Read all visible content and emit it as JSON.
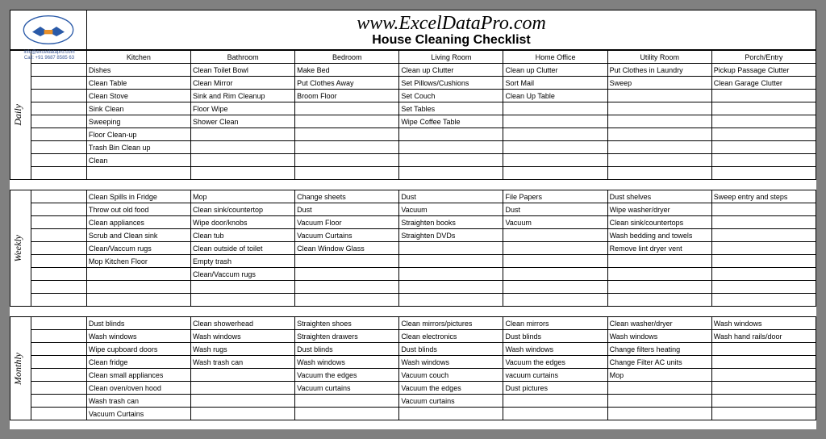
{
  "site": {
    "url": "www.ExcelDataPro.com",
    "title": "House Cleaning Checklist"
  },
  "contact": {
    "email": "info@exceldatapro.com",
    "phone": "Call: +91 9687 8585 63"
  },
  "cols": [
    "Kitchen",
    "Bathroom",
    "Bedroom",
    "Living Room",
    "Home Office",
    "Utility Room",
    "Porch/Entry"
  ],
  "sections": [
    {
      "label": "Daily",
      "rows": [
        [
          "Dishes",
          "Clean Toilet Bowl",
          "Make Bed",
          "Clean up Clutter",
          "Clean up Clutter",
          "Put Clothes in Laundry",
          "Pickup Passage Clutter"
        ],
        [
          "Clean Table",
          "Clean Mirror",
          "Put Clothes Away",
          "Set Pillows/Cushions",
          "Sort Mail",
          "Sweep",
          "Clean Garage Clutter"
        ],
        [
          "Clean Stove",
          "Sink and Rim Cleanup",
          "Broom Floor",
          "Set Couch",
          "Clean Up Table",
          "",
          ""
        ],
        [
          "Sink Clean",
          "Floor Wipe",
          "",
          "Set Tables",
          "",
          "",
          ""
        ],
        [
          "Sweeping",
          "Shower Clean",
          "",
          "Wipe Coffee Table",
          "",
          "",
          ""
        ],
        [
          "Floor Clean-up",
          "",
          "",
          "",
          "",
          "",
          ""
        ],
        [
          "Trash Bin Clean up",
          "",
          "",
          "",
          "",
          "",
          ""
        ],
        [
          "Clean",
          "",
          "",
          "",
          "",
          "",
          ""
        ],
        [
          "",
          "",
          "",
          "",
          "",
          "",
          ""
        ]
      ]
    },
    {
      "label": "Weekly",
      "rows": [
        [
          "Clean Spills in Fridge",
          "Mop",
          "Change sheets",
          "Dust",
          "File Papers",
          "Dust shelves",
          "Sweep entry and steps"
        ],
        [
          "Throw out old food",
          "Clean sink/countertop",
          "Dust",
          "Vacuum",
          "Dust",
          "Wipe washer/dryer",
          ""
        ],
        [
          "Clean appliances",
          "Wipe door/knobs",
          "Vacuum Floor",
          "Straighten books",
          "Vacuum",
          "Clean sink/countertops",
          ""
        ],
        [
          "Scrub and Clean sink",
          "Clean tub",
          "Vacuum Curtains",
          "Straighten DVDs",
          "",
          "Wash bedding and towels",
          ""
        ],
        [
          "Clean/Vaccum rugs",
          "Clean outside of toilet",
          "Clean Window Glass",
          "",
          "",
          "Remove lint dryer vent",
          ""
        ],
        [
          "Mop Kitchen Floor",
          "Empty trash",
          "",
          "",
          "",
          "",
          ""
        ],
        [
          "",
          "Clean/Vaccum rugs",
          "",
          "",
          "",
          "",
          ""
        ],
        [
          "",
          "",
          "",
          "",
          "",
          "",
          ""
        ],
        [
          "",
          "",
          "",
          "",
          "",
          "",
          ""
        ]
      ]
    },
    {
      "label": "Monthly",
      "rows": [
        [
          "Dust blinds",
          "Clean showerhead",
          "Straighten shoes",
          "Clean mirrors/pictures",
          "Clean mirrors",
          "Clean washer/dryer",
          "Wash windows"
        ],
        [
          "Wash windows",
          "Wash windows",
          "Straighten drawers",
          "Clean electronics",
          "Dust blinds",
          "Wash windows",
          "Wash hand rails/door"
        ],
        [
          "Wipe cupboard doors",
          "Wash rugs",
          "Dust blinds",
          "Dust blinds",
          "Wash windows",
          "Change filters heating",
          ""
        ],
        [
          "Clean fridge",
          "Wash trash can",
          "Wash windows",
          "Wash windows",
          "Vacuum the edges",
          "Change Filter AC units",
          ""
        ],
        [
          "Clean small appliances",
          "",
          "Vacuum the edges",
          "Vacuum couch",
          "vacuum curtains",
          "Mop",
          ""
        ],
        [
          "Clean oven/oven hood",
          "",
          "Vacuum curtains",
          "Vacuum the edges",
          "Dust pictures",
          "",
          ""
        ],
        [
          "Wash trash can",
          "",
          "",
          "Vacuum curtains",
          "",
          "",
          ""
        ],
        [
          "Vacuum Curtains",
          "",
          "",
          "",
          "",
          "",
          ""
        ]
      ]
    }
  ],
  "chart_data": {
    "type": "table",
    "headers": [
      "Kitchen",
      "Bathroom",
      "Bedroom",
      "Living Room",
      "Home Office",
      "Utility Room",
      "Porch/Entry"
    ],
    "sections": [
      "Daily",
      "Weekly",
      "Monthly"
    ]
  }
}
